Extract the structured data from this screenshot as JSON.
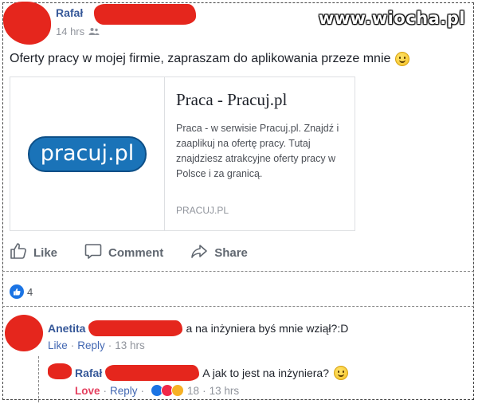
{
  "watermark": "www.wiocha.pl",
  "post": {
    "author": "Rafał",
    "time": "14 hrs",
    "text": "Oferty pracy w mojej firmie, zapraszam do aplikowania przeze mnie"
  },
  "link_card": {
    "logo_text": "pracuj.pl",
    "title": "Praca - Pracuj.pl",
    "description": "Praca - w serwisie Pracuj.pl. Znajdź i zaaplikuj na ofertę pracy. Tutaj znajdziesz atrakcyjne oferty pracy w Polsce i za granicą.",
    "domain": "PRACUJ.PL"
  },
  "actions": {
    "like": "Like",
    "comment": "Comment",
    "share": "Share"
  },
  "reactions": {
    "count": "4"
  },
  "comments": [
    {
      "author": "Anetita",
      "text": "a na inżyniera byś mnie wziął?:D",
      "like": "Like",
      "reply": "Reply",
      "time": "13 hrs"
    }
  ],
  "reply": {
    "author": "Rafał",
    "text": "A jak to jest na inżyniera?",
    "love": "Love",
    "reply": "Reply",
    "reaction_count": "18",
    "time": "13 hrs"
  },
  "colors": {
    "link": "#365899",
    "redaction": "#e5261d",
    "love": "#e4405f",
    "brand": "#1a73b8"
  }
}
